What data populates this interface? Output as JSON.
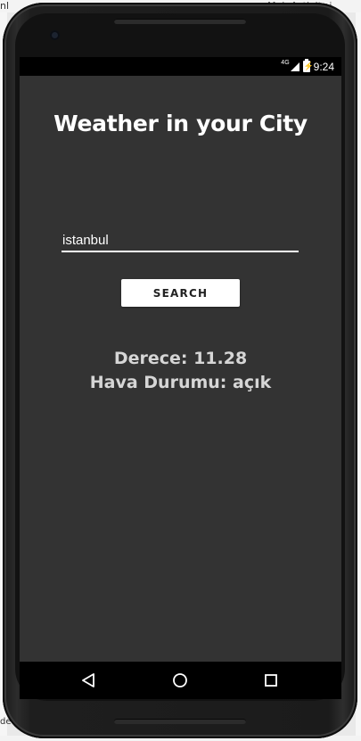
{
  "desktop": {
    "top_left_fragment": "nl",
    "top_right_fragment": "MainActivity.j",
    "bottom_left_fragment": "de"
  },
  "status_bar": {
    "network": "4G",
    "time": "9:24"
  },
  "app": {
    "title": "Weather in your City",
    "city_input_value": "istanbul",
    "search_button_label": "SEARCH",
    "temperature_text": "Derece: 11.28",
    "condition_text": "Hava Durumu: açık"
  },
  "nav_bar": {
    "back_icon": "triangle-back-icon",
    "home_icon": "circle-home-icon",
    "recents_icon": "square-recents-icon"
  },
  "colors": {
    "screen_background": "#333333",
    "title_text": "#ffffff",
    "result_text": "#d6d6d6",
    "button_background": "#ffffff"
  }
}
